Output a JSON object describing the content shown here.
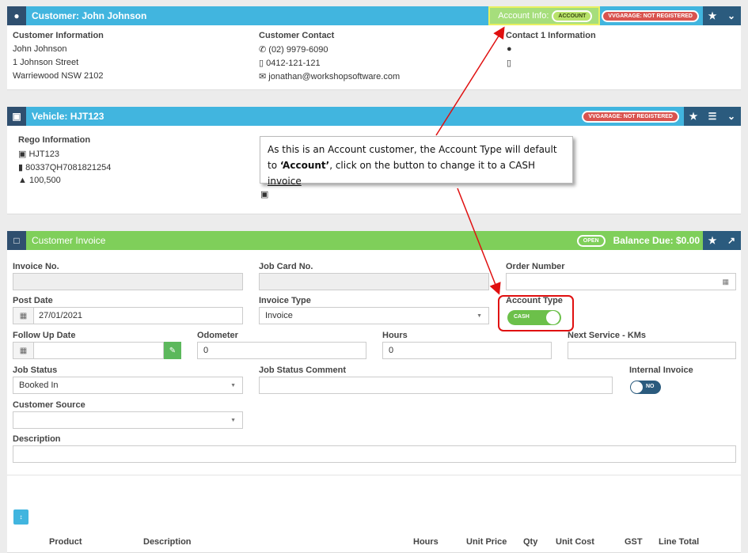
{
  "customer": {
    "header": "Customer: John Johnson",
    "account_info_label": "Account Info:",
    "account_badge": "ACCOUNT",
    "vvgarage_badge": "VVGARAGE: NOT REGISTERED",
    "info_title": "Customer Information",
    "name": "John Johnson",
    "address1": "1 Johnson Street",
    "address2": "Warriewood NSW 2102",
    "contact_title": "Customer Contact",
    "phone": "(02) 9979-6090",
    "mobile": "0412-121-121",
    "email": "jonathan@workshopsoftware.com",
    "contact1_title": "Contact 1 Information"
  },
  "vehicle": {
    "header": "Vehicle: HJT123",
    "vvgarage_badge": "VVGARAGE: NOT REGISTERED",
    "rego_title": "Rego Information",
    "rego": "HJT123",
    "vin": "80337QH7081821254",
    "odometer": "100,500"
  },
  "callout": {
    "line1": "As this is an Account customer, the Account Type will default",
    "line2_pre": "to ",
    "line2_bold": "‘Account’",
    "line2_mid": ", click  on the button to change it to a CASH ",
    "line2_under": "invoice"
  },
  "invoice": {
    "header": "Customer Invoice",
    "status_badge": "OPEN",
    "balance_due": "Balance Due: $0.00",
    "invoice_no_label": "Invoice No.",
    "job_card_label": "Job Card No.",
    "order_number_label": "Order Number",
    "post_date_label": "Post Date",
    "post_date": "27/01/2021",
    "invoice_type_label": "Invoice Type",
    "invoice_type": "Invoice",
    "account_type_label": "Account Type",
    "account_type_value": "CASH",
    "follow_up_label": "Follow Up Date",
    "odometer_label": "Odometer",
    "odometer": "0",
    "hours_label": "Hours",
    "hours": "0",
    "next_service_label": "Next Service - KMs",
    "job_status_label": "Job Status",
    "job_status": "Booked In",
    "job_status_comment_label": "Job Status Comment",
    "internal_invoice_label": "Internal Invoice",
    "internal_invoice_value": "NO",
    "customer_source_label": "Customer Source",
    "description_label": "Description"
  },
  "table_headers": [
    "Product",
    "Description",
    "Hours",
    "Unit Price",
    "Qty",
    "Unit Cost",
    "GST",
    "Line Total"
  ],
  "colors": {
    "blue_header": "#41b5df",
    "green_header": "#7fcf5a",
    "dark_button": "#2b5b7e",
    "annotation_red": "#e01010"
  }
}
